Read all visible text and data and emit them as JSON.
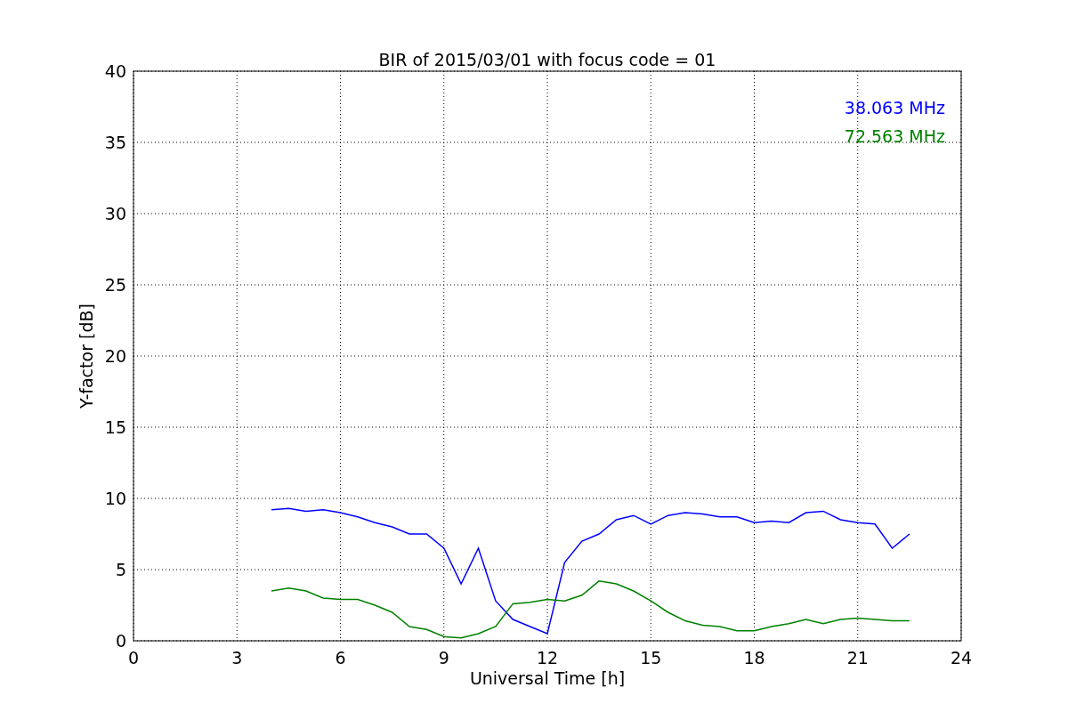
{
  "chart_data": {
    "type": "line",
    "title": "BIR of 2015/03/01 with focus code = 01",
    "xlabel": "Universal Time [h]",
    "ylabel": "Y-factor [dB]",
    "x": [
      4,
      4.5,
      5,
      5.5,
      6,
      6.5,
      7,
      7.5,
      8,
      8.5,
      9,
      9.5,
      10,
      10.5,
      11,
      11.5,
      12,
      12.5,
      13,
      13.5,
      14,
      14.5,
      15,
      15.5,
      16,
      16.5,
      17,
      17.5,
      18,
      18.5,
      19,
      19.5,
      20,
      20.5,
      21,
      21.5,
      22,
      22.5
    ],
    "series": [
      {
        "name": "38.063 MHz",
        "color": "#0000ff",
        "values": [
          9.2,
          9.3,
          9.1,
          9.2,
          9.0,
          8.7,
          8.3,
          8.0,
          7.5,
          7.5,
          6.5,
          4.0,
          6.5,
          2.8,
          1.5,
          1.0,
          0.5,
          5.5,
          7.0,
          7.5,
          8.5,
          8.8,
          8.2,
          8.8,
          9.0,
          8.9,
          8.7,
          8.7,
          8.3,
          8.4,
          8.3,
          9.0,
          9.1,
          8.5,
          8.3,
          8.2,
          6.5,
          7.5
        ]
      },
      {
        "name": "72.563 MHz",
        "color": "#008000",
        "values": [
          3.5,
          3.7,
          3.5,
          3.0,
          2.9,
          2.9,
          2.5,
          2.0,
          1.0,
          0.8,
          0.3,
          0.2,
          0.5,
          1.0,
          2.6,
          2.7,
          2.9,
          2.8,
          3.2,
          4.2,
          4.0,
          3.5,
          2.8,
          2.0,
          1.4,
          1.1,
          1.0,
          0.7,
          0.7,
          1.0,
          1.2,
          1.5,
          1.2,
          1.5,
          1.6,
          1.5,
          1.4,
          1.4
        ]
      }
    ],
    "grid": true,
    "xlim": [
      0,
      24
    ],
    "ylim": [
      0,
      40
    ],
    "xticks": [
      0,
      3,
      6,
      9,
      12,
      15,
      18,
      21,
      24
    ],
    "yticks": [
      0,
      5,
      10,
      15,
      20,
      25,
      30,
      35,
      40
    ]
  }
}
